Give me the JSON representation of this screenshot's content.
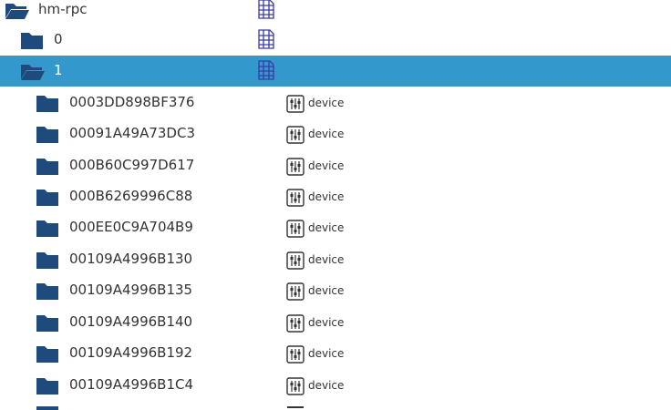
{
  "tree": {
    "root": {
      "label": "hm-rpc",
      "icon": "folder-open-icon",
      "type_icon": "table-icon"
    },
    "channels": [
      {
        "label": "0",
        "icon": "folder-icon",
        "type_icon": "table-icon",
        "selected": false
      },
      {
        "label": "1",
        "icon": "folder-open-icon",
        "type_icon": "table-icon",
        "selected": true
      }
    ],
    "devices": [
      {
        "label": "0003DD898BF376",
        "type": "device"
      },
      {
        "label": "00091A49A73DC3",
        "type": "device"
      },
      {
        "label": "000B60C997D617",
        "type": "device"
      },
      {
        "label": "000B6269996C88",
        "type": "device"
      },
      {
        "label": "000EE0C9A704B9",
        "type": "device"
      },
      {
        "label": "00109A4996B130",
        "type": "device"
      },
      {
        "label": "00109A4996B135",
        "type": "device"
      },
      {
        "label": "00109A4996B140",
        "type": "device"
      },
      {
        "label": "00109A4996B192",
        "type": "device"
      },
      {
        "label": "00109A4996B1C4",
        "type": "device"
      }
    ]
  },
  "colors": {
    "folder": "#1e4a7c",
    "selection": "#3399cc",
    "table_icon": "#3a3aa8",
    "device_icon": "#333333"
  }
}
